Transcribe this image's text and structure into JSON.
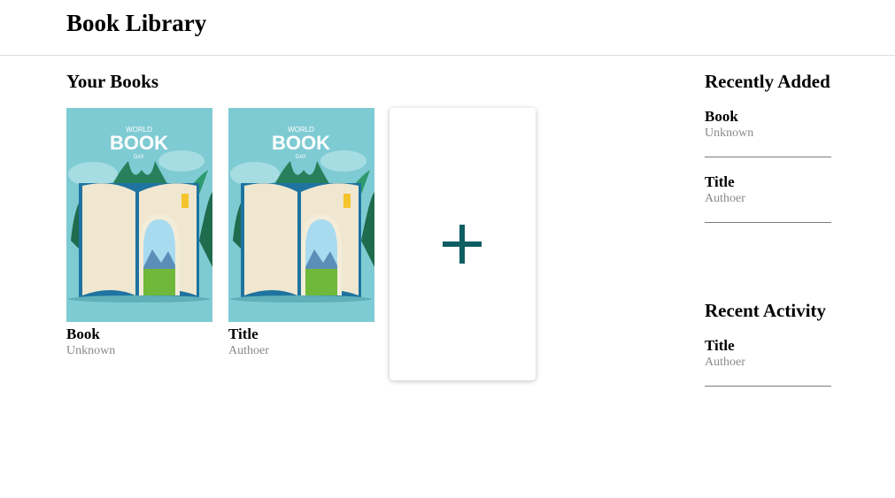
{
  "header": {
    "title": "Book Library"
  },
  "main": {
    "section_title": "Your Books",
    "books": [
      {
        "title": "Book",
        "author": "Unknown",
        "cover": {
          "line1": "WORLD",
          "line2": "BOOK",
          "line3": "DAY"
        }
      },
      {
        "title": "Title",
        "author": "Authoer",
        "cover": {
          "line1": "WORLD",
          "line2": "BOOK",
          "line3": "DAY"
        }
      }
    ],
    "add_book": {
      "icon": "plus-icon"
    }
  },
  "sidebar": {
    "recently_added": {
      "title": "Recently Added",
      "items": [
        {
          "title": "Book",
          "author": "Unknown"
        },
        {
          "title": "Title",
          "author": "Authoer"
        }
      ]
    },
    "recent_activity": {
      "title": "Recent Activity",
      "items": [
        {
          "title": "Title",
          "author": "Authoer"
        }
      ]
    }
  },
  "colors": {
    "accent": "#0f5e63",
    "cover_bg": "#7fcbd3"
  }
}
